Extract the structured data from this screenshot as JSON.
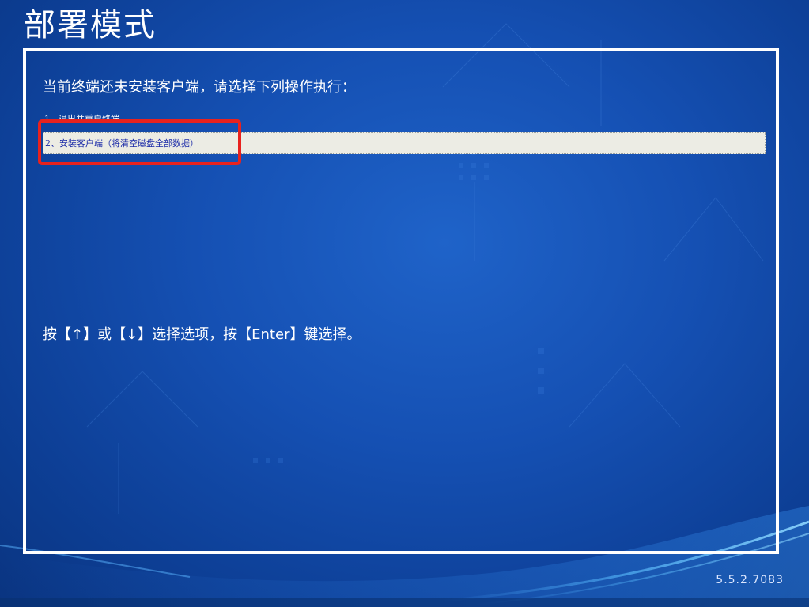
{
  "page": {
    "title": "部署模式",
    "version": "5.5.2.7083"
  },
  "panel": {
    "prompt": "当前终端还未安装客户端，请选择下列操作执行：",
    "menu": [
      {
        "label": "1、退出并重启终端",
        "selected": false
      },
      {
        "label": "2、安装客户端（将清空磁盘全部数据）",
        "selected": true
      }
    ],
    "hint": "按【↑】或【↓】选择选项，按【Enter】键选择。"
  },
  "colors": {
    "background": "#1550b3",
    "panel_border": "#ffffff",
    "selected_item_bg": "#ecece4",
    "selected_item_text": "#1a2aa8",
    "annotation_box": "#e8221e"
  }
}
